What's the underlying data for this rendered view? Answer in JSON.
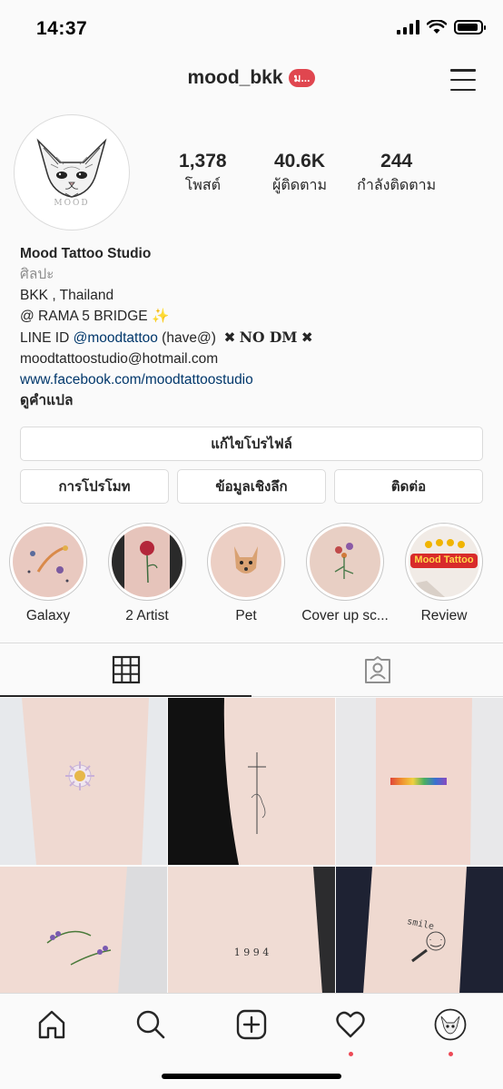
{
  "status_bar": {
    "time": "14:37",
    "battery_level": 0.9
  },
  "header": {
    "username": "mood_bkk",
    "notification_badge": "ม..."
  },
  "profile": {
    "avatar_text": "MOOD",
    "stats": [
      {
        "value": "1,378",
        "label": "โพสต์"
      },
      {
        "value": "40.6K",
        "label": "ผู้ติดตาม"
      },
      {
        "value": "244",
        "label": "กำลังติดตาม"
      }
    ]
  },
  "bio": {
    "name": "Mood Tattoo Studio",
    "category": "ศิลปะ",
    "line1": "BKK , Thailand",
    "line2": "@ RAMA 5 BRIDGE",
    "line2_emoji": "✨",
    "line3_prefix": "LINE ID ",
    "line3_mention": "@moodtattoo",
    "line3_suffix": " (have@)",
    "line3_x1": "✖",
    "line3_nodm": "NO DM",
    "line3_x2": "✖",
    "email": "moodtattoostudio@hotmail.com",
    "website": "www.facebook.com/moodtattoostudio",
    "translate": "ดูคำแปล"
  },
  "buttons": {
    "edit_profile": "แก้ไขโปรไฟล์",
    "promote": "การโปรโมท",
    "insights": "ข้อมูลเชิงลึก",
    "contact": "ติดต่อ"
  },
  "highlights": [
    {
      "label": "Galaxy"
    },
    {
      "label": "2 Artist"
    },
    {
      "label": "Pet"
    },
    {
      "label": "Cover up sc..."
    },
    {
      "label": "Review",
      "image_text": "Mood Tattoo"
    }
  ],
  "grid_posts": [
    {
      "caption": ""
    },
    {
      "caption": ""
    },
    {
      "caption": ""
    },
    {
      "caption": ""
    },
    {
      "caption": "1 9 9 4"
    },
    {
      "caption": "smile"
    }
  ],
  "colors": {
    "accent_link": "#00376b",
    "notification_red": "#e0464f",
    "border": "#dbdbdb"
  }
}
